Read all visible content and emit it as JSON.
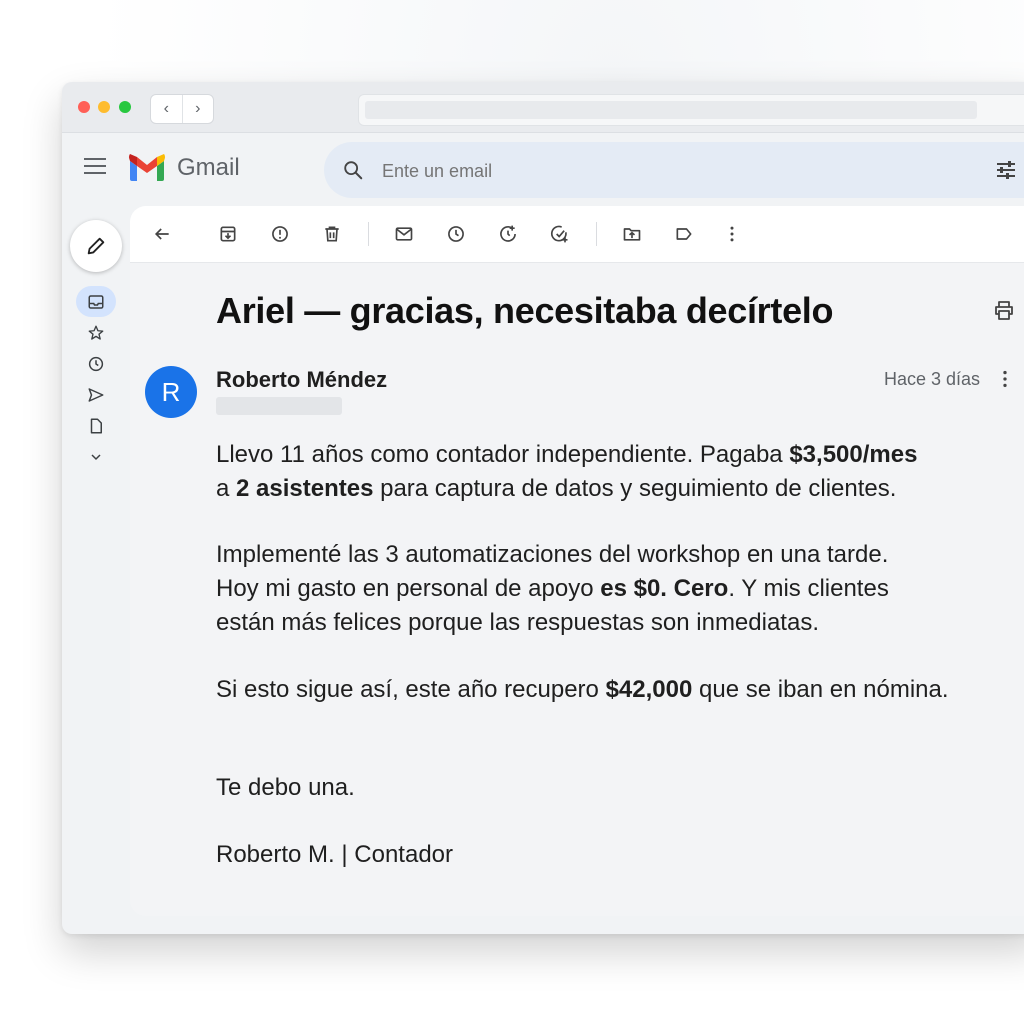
{
  "app": {
    "name": "Gmail"
  },
  "search": {
    "placeholder": "Ente un email"
  },
  "email": {
    "subject": "Ariel — gracias, necesitaba decírtelo",
    "avatar_initial": "R",
    "sender_name": "Roberto Méndez",
    "time": "Hace 3 días",
    "body": {
      "p1_a": "Llevo 11 años como contador independiente. Pagaba ",
      "p1_b": "$3,500/mes",
      "p1_c": "a ",
      "p1_d": "2 asistentes",
      "p1_e": " para captura de datos y seguimiento de clientes.",
      "p2_a": "Implementé las 3 automatizaciones del workshop en una tarde.",
      "p2_b": "Hoy mi gasto en personal de apoyo ",
      "p2_c": "es $0. Cero",
      "p2_d": ". Y mis clientes",
      "p2_e": "están más felices porque las respuestas son inmediatas.",
      "p3_a": "Si esto sigue así, este año recupero ",
      "p3_b": "$42,000",
      "p3_c": " que se iban en nómina.",
      "p4": "Te debo una.",
      "p5": "Roberto M. | Contador"
    }
  },
  "colors": {
    "accent": "#1a73e8",
    "search_bg": "#e4ebf5",
    "active_rail": "#d3e3fd"
  }
}
